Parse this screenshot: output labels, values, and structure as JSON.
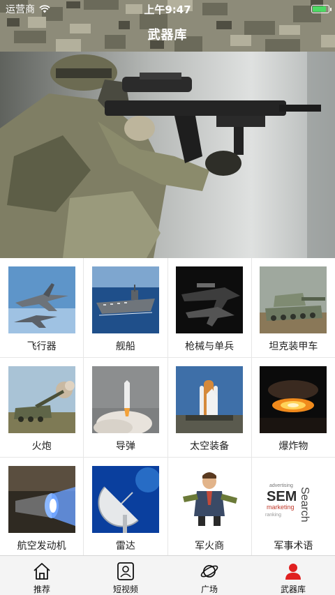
{
  "status_bar": {
    "carrier": "运营商",
    "time": "上午9:47",
    "battery_level": 0.85,
    "battery_color": "#4cd964"
  },
  "header": {
    "title": "武器库"
  },
  "hero": {
    "subject": "armed-soldier-photo"
  },
  "categories": [
    {
      "label": "飞行器",
      "icon": "fighter-jet-photo"
    },
    {
      "label": "舰船",
      "icon": "aircraft-carrier-photo"
    },
    {
      "label": "枪械与单兵",
      "icon": "rifle-photo"
    },
    {
      "label": "坦克装甲车",
      "icon": "tank-photo"
    },
    {
      "label": "火炮",
      "icon": "artillery-photo"
    },
    {
      "label": "导弹",
      "icon": "missile-photo"
    },
    {
      "label": "太空装备",
      "icon": "space-shuttle-photo"
    },
    {
      "label": "爆炸物",
      "icon": "explosion-photo"
    },
    {
      "label": "航空发动机",
      "icon": "jet-engine-photo"
    },
    {
      "label": "雷达",
      "icon": "radar-dish-photo"
    },
    {
      "label": "军火商",
      "icon": "arms-dealer-illustration"
    },
    {
      "label": "军事术语",
      "icon": "word-cloud-image"
    }
  ],
  "tab_bar": {
    "active_color": "#e02020",
    "tabs": [
      {
        "label": "推荐",
        "icon": "home-icon",
        "active": false
      },
      {
        "label": "短视频",
        "icon": "video-user-icon",
        "active": false
      },
      {
        "label": "广场",
        "icon": "planet-icon",
        "active": false
      },
      {
        "label": "武器库",
        "icon": "user-profile-icon",
        "active": true
      }
    ]
  }
}
